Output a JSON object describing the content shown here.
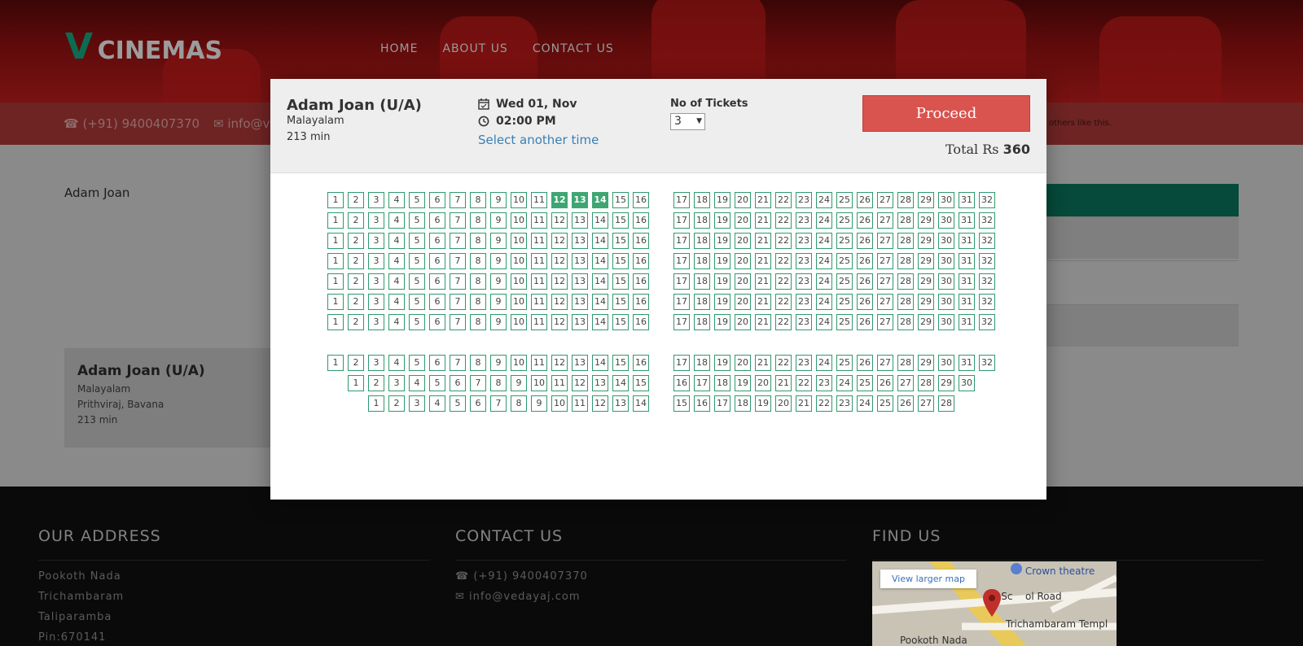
{
  "brand": {
    "v": "V",
    "name": "CINEMAS"
  },
  "nav": [
    "HOME",
    "ABOUT US",
    "CONTACT US"
  ],
  "contactbar": {
    "phone": "(+91) 9400407370",
    "email": "info@v",
    "tagline": "others like this."
  },
  "background": {
    "movie_name": "Adam Joan",
    "card": {
      "title": "Adam Joan (U/A)",
      "language": "Malayalam",
      "cast": "Prithviraj, Bavana",
      "duration": "213 min"
    }
  },
  "footer": {
    "address": {
      "heading": "OUR ADDRESS",
      "lines": [
        "Pookoth Nada",
        "Trichambaram",
        "Taliparamba",
        "Pin:670141"
      ]
    },
    "contact": {
      "heading": "CONTACT US",
      "phone": "(+91) 9400407370",
      "email": "info@vedayaj.com"
    },
    "find": {
      "heading": "FIND US",
      "map_button": "View larger map",
      "labels": [
        "Crown theatre",
        "ya Sc",
        "ol Road",
        "Trichambaram Templ",
        "Pookoth Nada"
      ]
    }
  },
  "modal": {
    "title": "Adam Joan (U/A)",
    "language": "Malayalam",
    "duration": "213 min",
    "date": "Wed 01, Nov",
    "time": "02:00 PM",
    "change_time_link": "Select another time",
    "tickets_label": "No of Tickets",
    "tickets_value": "3",
    "proceed_label": "Proceed",
    "total_prefix": "Total Rs",
    "total_amount": "360",
    "seat_rows": [
      {
        "left": [
          1,
          16
        ],
        "right": [
          17,
          32
        ],
        "selected": [
          12,
          13,
          14
        ]
      },
      {
        "left": [
          1,
          16
        ],
        "right": [
          17,
          32
        ],
        "selected": []
      },
      {
        "left": [
          1,
          16
        ],
        "right": [
          17,
          32
        ],
        "selected": []
      },
      {
        "left": [
          1,
          16
        ],
        "right": [
          17,
          32
        ],
        "selected": []
      },
      {
        "left": [
          1,
          16
        ],
        "right": [
          17,
          32
        ],
        "selected": []
      },
      {
        "left": [
          1,
          16
        ],
        "right": [
          17,
          32
        ],
        "selected": []
      },
      {
        "left": [
          1,
          16
        ],
        "right": [
          17,
          32
        ],
        "selected": []
      },
      {
        "left": [
          1,
          16
        ],
        "right": [
          17,
          32
        ],
        "selected": []
      },
      {
        "left": [
          1,
          15
        ],
        "right": [
          16,
          30
        ],
        "selected": []
      },
      {
        "left": [
          1,
          14
        ],
        "right": [
          15,
          28
        ],
        "selected": []
      }
    ]
  }
}
